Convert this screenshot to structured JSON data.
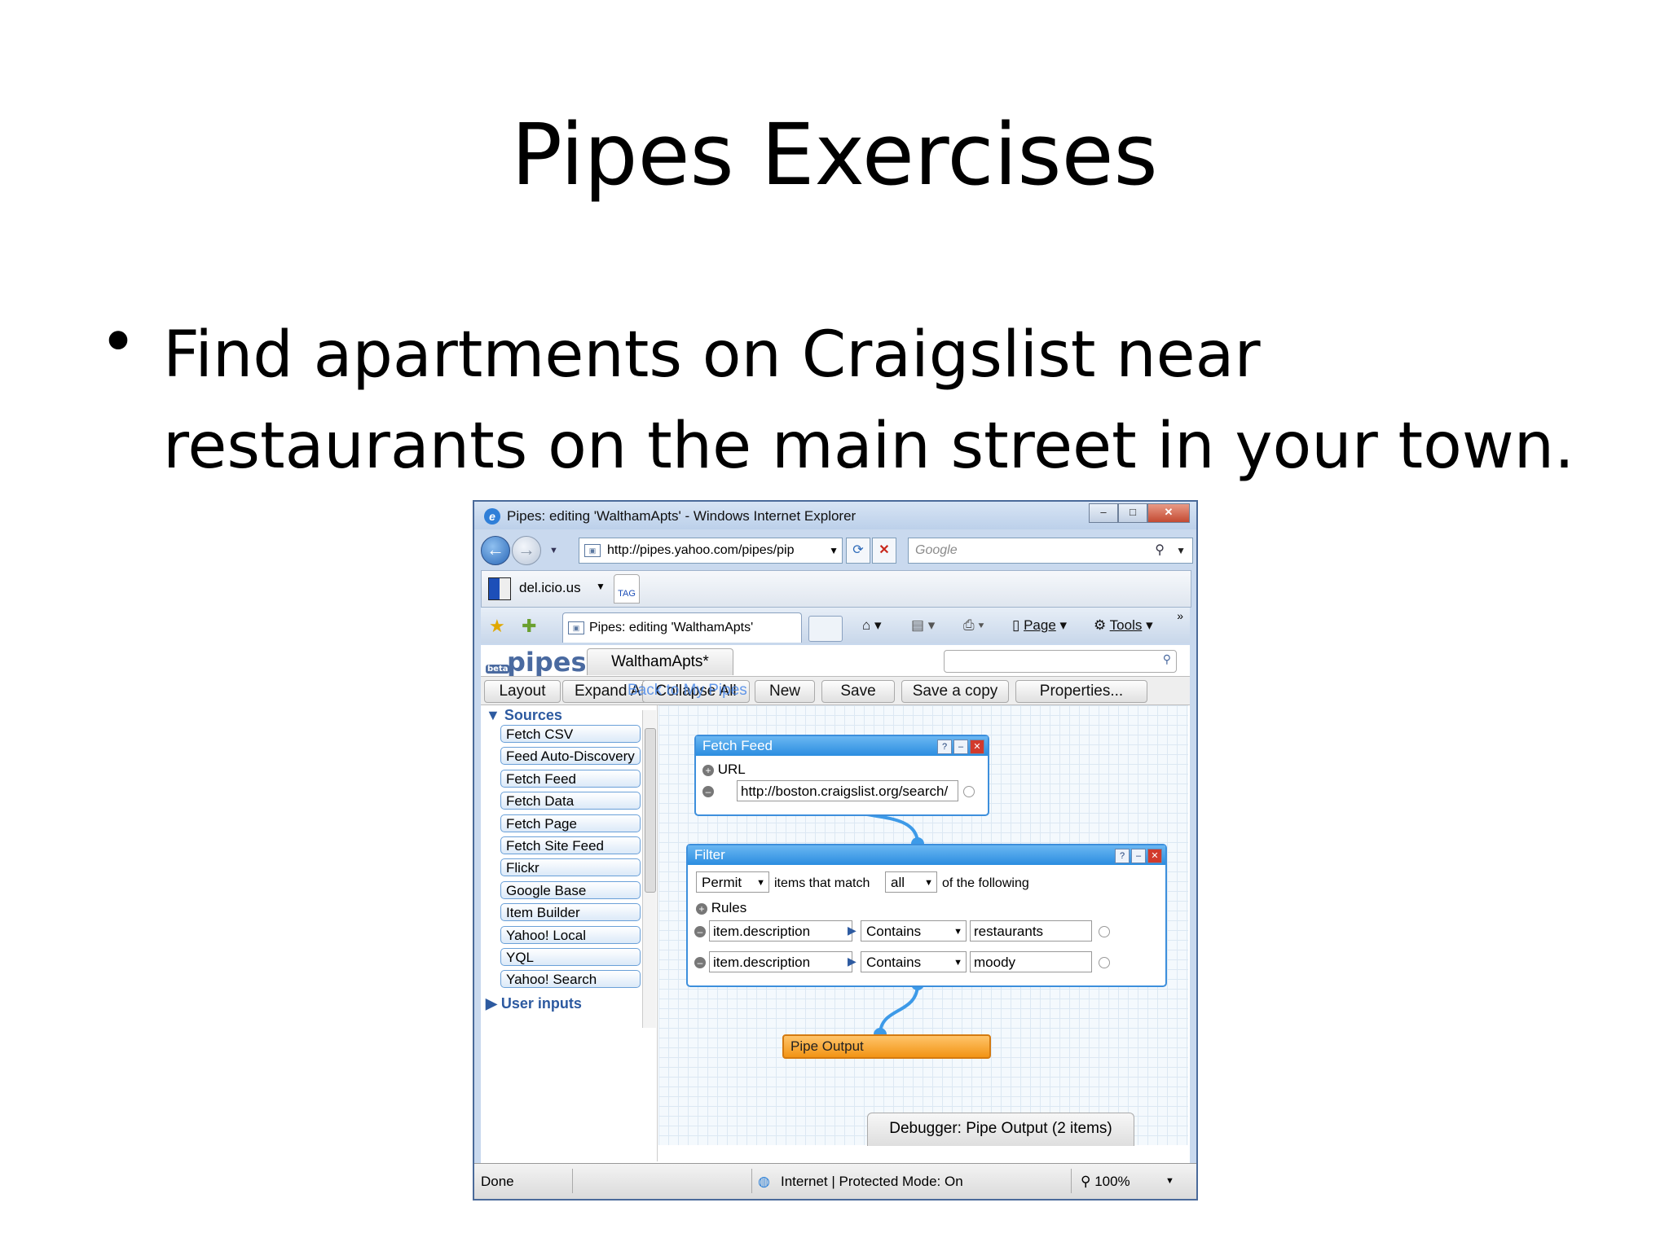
{
  "slide": {
    "title": "Pipes Exercises",
    "bullet_symbol": "•",
    "bullet_text": "Find apartments on Craigslist near restaurants on the main street in your town."
  },
  "browser": {
    "window_title": "Pipes: editing 'WalthamApts' - Windows Internet Explorer",
    "address": "http://pipes.yahoo.com/pipes/pip",
    "search_placeholder": "Google",
    "links_bar_item": "del.icio.us",
    "tag_label": "TAG",
    "tab_title": "Pipes: editing 'WalthamApts'",
    "commands": {
      "page": "Page",
      "tools": "Tools"
    },
    "status": {
      "left": "Done",
      "zone": "Internet | Protected Mode: On",
      "zoom": "100%"
    }
  },
  "pipes": {
    "logo": "pipes",
    "logo_badge": "beta",
    "pipe_tab": "WalthamApts*",
    "toolbar": {
      "layout": "Layout",
      "expand": "Expand All",
      "collapse": "Collapse All",
      "back": "Back to My Pipes",
      "new": "New",
      "save": "Save",
      "save_copy": "Save a copy",
      "properties": "Properties..."
    },
    "sidebar": {
      "sources_header": "Sources",
      "sources": [
        "Fetch CSV",
        "Feed Auto-Discovery",
        "Fetch Feed",
        "Fetch Data",
        "Fetch Page",
        "Fetch Site Feed",
        "Flickr",
        "Google Base",
        "Item Builder",
        "Yahoo! Local",
        "YQL",
        "Yahoo! Search"
      ],
      "user_inputs_header": "User inputs"
    },
    "fetch_feed": {
      "title": "Fetch Feed",
      "url_label": "URL",
      "url_value": "http://boston.craigslist.org/search/"
    },
    "filter": {
      "title": "Filter",
      "mode": "Permit",
      "items_text": "items that match",
      "match": "all",
      "following_text": "of the following",
      "rules_label": "Rules",
      "rules": [
        {
          "field": "item.description",
          "op": "Contains",
          "value": "restaurants"
        },
        {
          "field": "item.description",
          "op": "Contains",
          "value": "moody"
        }
      ]
    },
    "output": "Pipe Output",
    "debugger": "Debugger: Pipe Output (2 items)"
  }
}
